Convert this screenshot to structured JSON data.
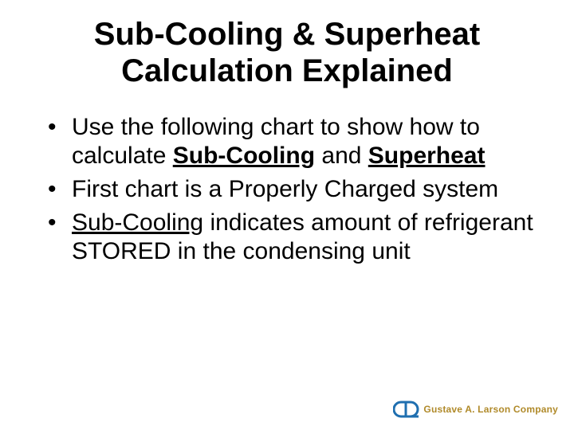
{
  "title": {
    "line1": "Sub-Cooling & Superheat",
    "line2": "Calculation Explained"
  },
  "bullets": [
    {
      "part1": "Use the following chart to show how to calculate ",
      "term1": "Sub-Cooling",
      "mid": " and ",
      "term2": "Superheat"
    },
    {
      "text": "First chart is a Properly Charged system"
    },
    {
      "term": "Sub-Cooling",
      "rest": " indicates amount of refrigerant STORED in the condensing unit"
    }
  ],
  "footer": {
    "company": "Gustave A. Larson Company",
    "logo_color_outer": "#1f6fb0",
    "logo_color_inner": "#1f6fb0"
  }
}
